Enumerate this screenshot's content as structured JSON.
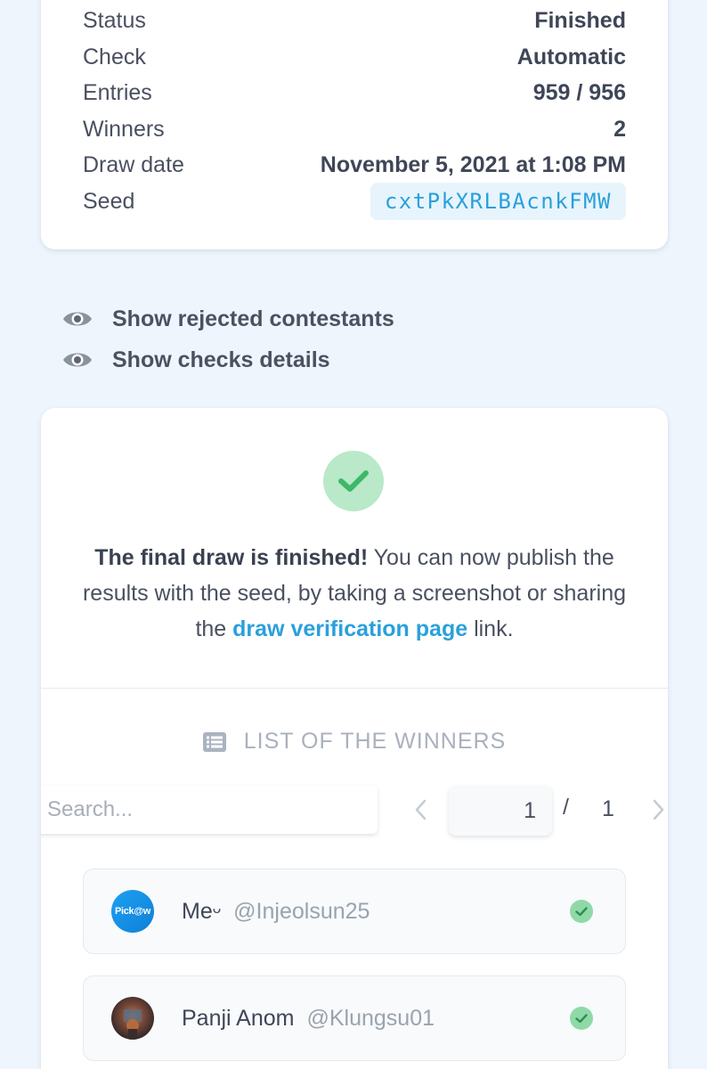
{
  "details": {
    "rows": [
      {
        "label": "Status",
        "value": "Finished"
      },
      {
        "label": "Check",
        "value": "Automatic"
      },
      {
        "label": "Entries",
        "value": "959 / 956"
      },
      {
        "label": "Winners",
        "value": "2"
      },
      {
        "label": "Draw date",
        "value": "November 5, 2021 at 1:08 PM"
      }
    ],
    "seed": {
      "label": "Seed",
      "value": "cxtPkXRLBAcnkFMW"
    }
  },
  "toggles": {
    "rejected": "Show rejected contestants",
    "checks": "Show checks details"
  },
  "result": {
    "bold": "The final draw is finished!",
    "text_before_link": " You can now publish the results with the seed, by taking a screenshot or sharing the ",
    "link": "draw verification page",
    "text_after_link": " link."
  },
  "winners_list": {
    "title": "LIST OF THE WINNERS",
    "search_placeholder": "Search...",
    "current_page": "1",
    "page_separator": "/",
    "total_pages": "1",
    "items": [
      {
        "name": "Meᵕ",
        "handle": "@Injeolsun25",
        "avatar_text": "Pick@w"
      },
      {
        "name": "Panji Anom",
        "handle": "@Klungsu01"
      }
    ]
  },
  "colors": {
    "background": "#eef5fc",
    "accent": "#2aa0db",
    "success": "#3fb868",
    "success_light": "#b9e9c8"
  },
  "icons": [
    "eye-icon",
    "check-icon",
    "list-icon",
    "chevron-left-icon",
    "chevron-right-icon"
  ]
}
